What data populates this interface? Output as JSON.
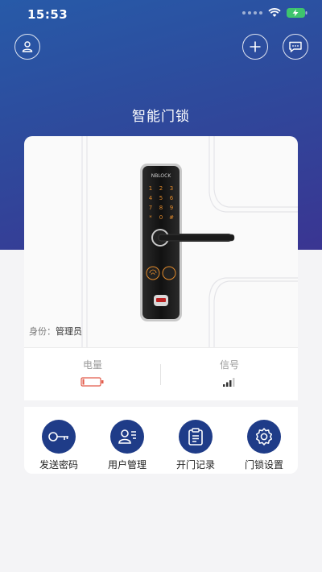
{
  "status_bar": {
    "time": "15:53"
  },
  "header": {
    "title": "智能门锁"
  },
  "lock": {
    "brand": "NBLOCK",
    "keys": [
      "1",
      "2",
      "3",
      "4",
      "5",
      "6",
      "7",
      "8",
      "9",
      "*",
      "0",
      "#"
    ]
  },
  "identity": {
    "label": "身份：",
    "role": "管理员"
  },
  "stats": {
    "battery_label": "电量",
    "battery_level": 0.1,
    "signal_label": "信号",
    "signal_bars_active": 3
  },
  "actions": [
    {
      "label": "发送密码",
      "icon": "key-icon"
    },
    {
      "label": "用户管理",
      "icon": "user-manage-icon"
    },
    {
      "label": "开门记录",
      "icon": "clipboard-icon"
    },
    {
      "label": "门锁设置",
      "icon": "gear-icon"
    }
  ],
  "colors": {
    "hero_start": "#275aa8",
    "hero_end": "#3a3592",
    "action_circle": "#1f3c88",
    "battery_low": "#e25b4a",
    "lock_accent": "#e38b2c"
  }
}
